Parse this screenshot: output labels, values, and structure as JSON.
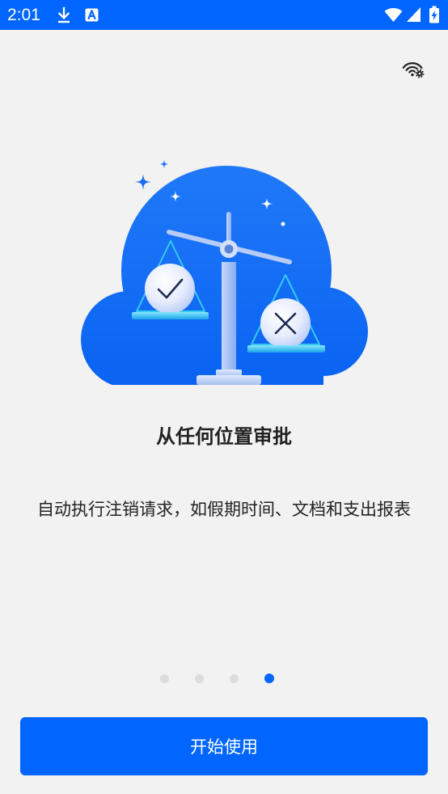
{
  "status_bar": {
    "time": "2:01",
    "left_icons": [
      "download-icon",
      "a-notification-icon"
    ],
    "right_icons": [
      "wifi-icon",
      "signal-icon",
      "battery-charging-icon"
    ]
  },
  "toolbar": {
    "network_settings_icon": "wifi-settings-icon"
  },
  "illustration": {
    "icon": "approval-scale-illustration"
  },
  "onboarding": {
    "title": "从任何位置审批",
    "description": "自动执行注销请求，如假期时间、文档和支出报表"
  },
  "pagination": {
    "count": 4,
    "active_index": 3
  },
  "actions": {
    "get_started_label": "开始使用"
  },
  "colors": {
    "primary": "#0066ff",
    "background": "#f2f2f2",
    "text": "#222222",
    "indicator_inactive": "#dcdcdc",
    "accent": "#35c9f0"
  }
}
